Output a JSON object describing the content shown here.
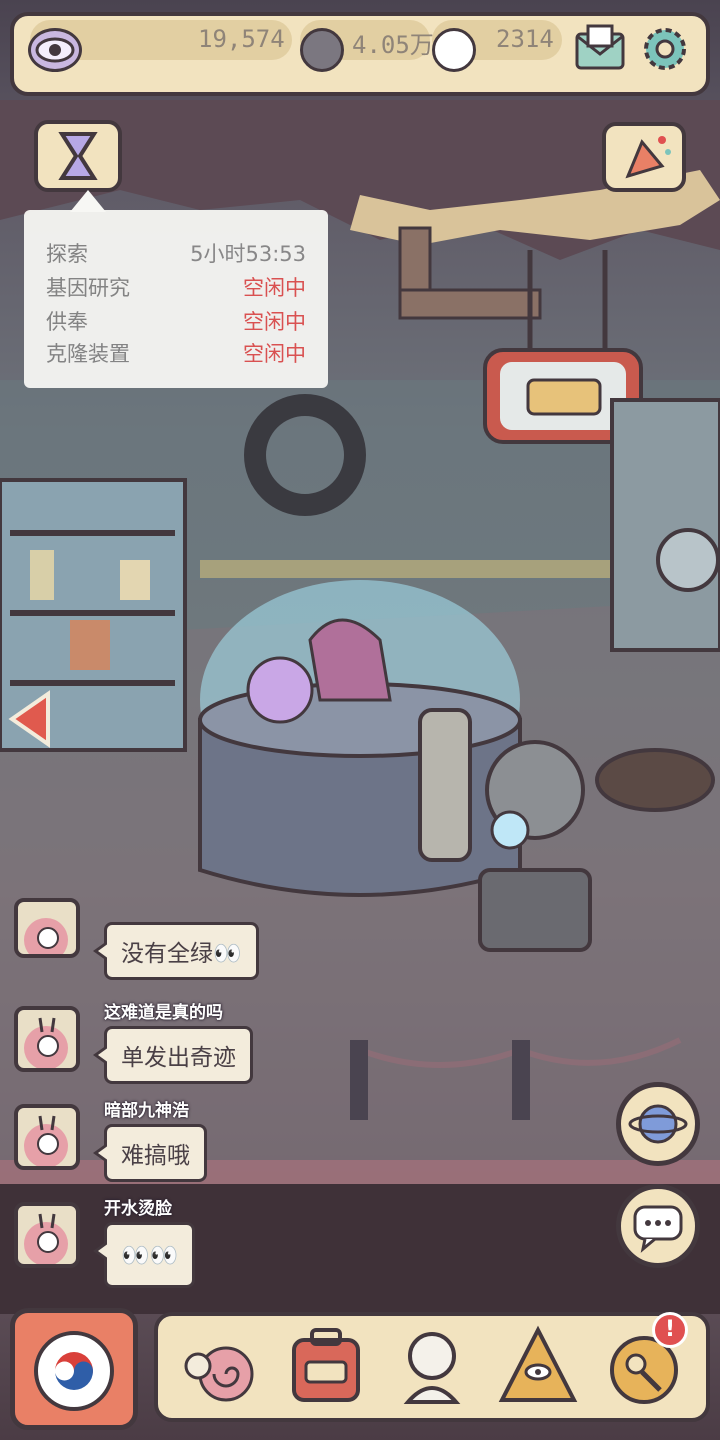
{
  "top_bar": {
    "eye_value": "19,574",
    "grey_bubble_value": "4.05万",
    "white_bubble_value": "2314",
    "eye_icon": "eye-icon",
    "mail_icon": "mail-icon",
    "settings_icon": "gear-icon"
  },
  "tasks": [
    {
      "label": "探索",
      "value": "5小时53:53",
      "color": "#8a8a8a"
    },
    {
      "label": "基因研究",
      "value": "空闲中",
      "color": "#e05050"
    },
    {
      "label": "供奉",
      "value": "空闲中",
      "color": "#e05050"
    },
    {
      "label": "克隆装置",
      "value": "空闲中",
      "color": "#e05050"
    }
  ],
  "chat": [
    {
      "nick": "",
      "text": "没有全绿👀"
    },
    {
      "nick": "这难道是真的吗",
      "text": "单发出奇迹"
    },
    {
      "nick": "暗部九神浩",
      "text": "难搞哦"
    },
    {
      "nick": "开水烫脸",
      "text": "👀👀"
    }
  ],
  "colors": {
    "panel": "#f2e3bf",
    "outline": "#43383e",
    "idle_red": "#e05050"
  },
  "icons": {
    "left_arrow": "left-arrow-icon",
    "planet": "planet-icon",
    "chat": "chat-icon",
    "party": "party-popper-icon",
    "bed_sign": "bed-icon"
  },
  "bottom_nav": [
    "snail-icon",
    "backpack-icon",
    "statue-icon",
    "pyramid-eye-icon",
    "key-icon"
  ],
  "notification_badge": "!"
}
